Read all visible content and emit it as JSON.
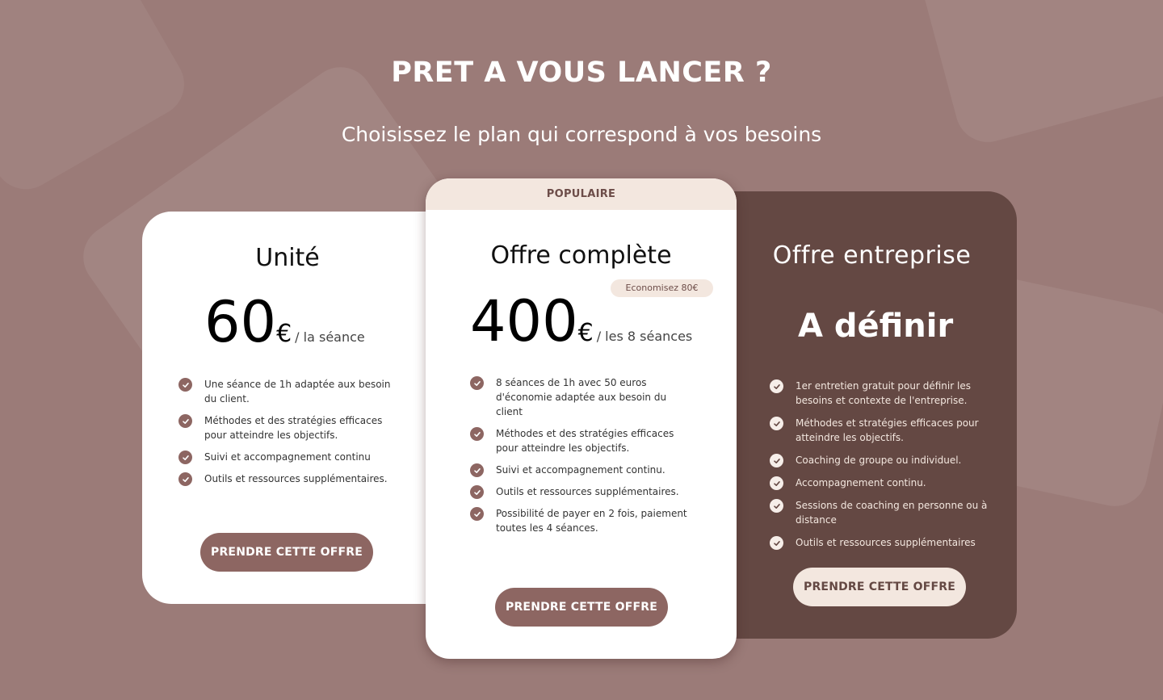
{
  "header": {
    "title": "PRET A VOUS LANCER ?",
    "subtitle": "Choisissez le plan qui correspond à vos besoins"
  },
  "plans": [
    {
      "title": "Unité",
      "price": "60",
      "currency": "€",
      "period": "/ la séance",
      "features": [
        "Une séance de 1h adaptée aux besoin du client.",
        "Méthodes et des stratégies efficaces pour atteindre les objectifs.",
        "Suivi et accompagnement continu",
        "Outils et ressources supplémentaires."
      ],
      "cta": "PRENDRE CETTE OFFRE"
    },
    {
      "ribbon": "POPULAIRE",
      "title": "Offre complète",
      "badge": "Economisez 80€",
      "price": "400",
      "currency": "€",
      "period": "/ les 8 séances",
      "features": [
        "8 séances de 1h avec 50 euros d'économie adaptée aux besoin du client",
        "Méthodes et des stratégies efficaces pour atteindre les objectifs.",
        "Suivi et accompagnement continu.",
        "Outils et ressources supplémentaires.",
        "Possibilité de payer en 2 fois, paiement toutes les 4 séances."
      ],
      "cta": "PRENDRE CETTE OFFRE"
    },
    {
      "title": "Offre entreprise",
      "price_text": "A définir",
      "features": [
        "1er entretien gratuit pour définir les besoins et contexte de l'entreprise.",
        "Méthodes et stratégies efficaces pour atteindre les objectifs.",
        "Coaching de groupe ou individuel.",
        "Accompagnement continu.",
        "Sessions de coaching en personne ou à distance",
        "Outils et ressources supplémentaires"
      ],
      "cta": "PRENDRE CETTE OFFRE"
    }
  ],
  "icons": {
    "feature": "check-circle-icon"
  },
  "colors": {
    "background": "#9b7b78",
    "accent": "#8d6662",
    "dark_card": "#644843",
    "cream": "#f3e7df"
  }
}
